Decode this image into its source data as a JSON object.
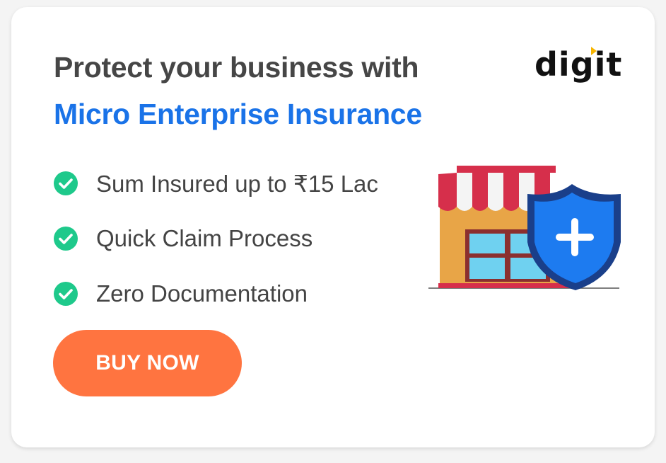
{
  "header": {
    "headline": "Protect your business with",
    "subheadline": "Micro Enterprise Insurance",
    "logo_text": "digit"
  },
  "features": [
    {
      "label": "Sum Insured up to ₹15 Lac",
      "icon": "check-circle-icon"
    },
    {
      "label": "Quick Claim Process",
      "icon": "check-circle-icon"
    },
    {
      "label": "Zero Documentation",
      "icon": "check-circle-icon"
    }
  ],
  "cta": {
    "label": "BUY NOW"
  },
  "illustration": {
    "shop_icon": "shop-icon",
    "shield_icon": "shield-plus-icon"
  },
  "colors": {
    "headline": "#464646",
    "accent_blue": "#1a73e8",
    "check_green": "#1ec98b",
    "button_orange": "#ff7440"
  }
}
